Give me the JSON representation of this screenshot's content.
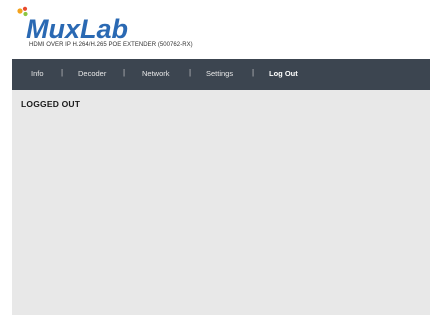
{
  "brand": {
    "logo_text": "MuxLab",
    "subtitle": "HDMI OVER IP H.264/H.265 POE EXTENDER (500762-RX)",
    "colors": {
      "logo_blue": "#2a69b3",
      "logo_dots": [
        "#f4a21c",
        "#e84a2e",
        "#8dc63f"
      ]
    }
  },
  "nav": {
    "items": [
      {
        "label": "Info"
      },
      {
        "label": "Decoder"
      },
      {
        "label": "Network"
      },
      {
        "label": "Settings"
      },
      {
        "label": "Log Out",
        "active": true
      }
    ],
    "separator": "|",
    "background": "#3c4550"
  },
  "main": {
    "status_title": "LOGGED OUT",
    "background": "#e8e8e8"
  }
}
